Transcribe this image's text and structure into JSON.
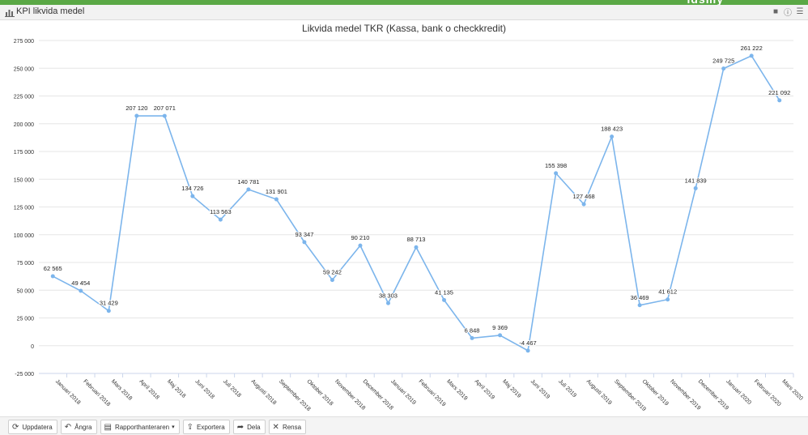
{
  "brand": "ldsmy",
  "panel": {
    "title": "KPI likvida medel"
  },
  "header_icons": [
    "comment-icon",
    "info-icon",
    "menu-icon"
  ],
  "chart_data": {
    "type": "line",
    "title": "Likvida medel TKR (Kassa, bank o checkkredit)",
    "xlabel": "",
    "ylabel": "",
    "categories": [
      "Januari 2018",
      "Februari 2018",
      "Mars 2018",
      "April 2018",
      "Maj 2018",
      "Juni 2018",
      "Juli 2018",
      "Augusti 2018",
      "September 2018",
      "Oktober 2018",
      "November 2018",
      "December 2018",
      "Januari 2019",
      "Februari 2019",
      "Mars 2019",
      "April 2019",
      "Maj 2019",
      "Juni 2019",
      "Juli 2019",
      "Augusti 2019",
      "September 2019",
      "Oktober 2019",
      "November 2019",
      "December 2019",
      "Januari 2020",
      "Februari 2020",
      "Mars 2020"
    ],
    "values": [
      62565,
      49454,
      31429,
      207120,
      207071,
      134726,
      113563,
      140781,
      131901,
      93347,
      59242,
      90210,
      38303,
      88713,
      41135,
      6848,
      9369,
      -4467,
      155398,
      127468,
      188423,
      36469,
      41612,
      141839,
      249725,
      261222,
      221092
    ],
    "labels": [
      "62 565",
      "49 454",
      "31 429",
      "207 120",
      "207 071",
      "134 726",
      "113 563",
      "140 781",
      "131 901",
      "93 347",
      "59 242",
      "90 210",
      "38 303",
      "88 713",
      "41 135",
      "6 848",
      "9 369",
      "-4 467",
      "155 398",
      "127 468",
      "188 423",
      "36 469",
      "41 612",
      "141 839",
      "249 725",
      "261 222",
      "221 092"
    ],
    "yticks": [
      -25000,
      0,
      25000,
      50000,
      75000,
      100000,
      125000,
      150000,
      175000,
      200000,
      225000,
      250000,
      275000
    ],
    "ytick_labels": [
      "-25 000",
      "0",
      "25 000",
      "50 000",
      "75 000",
      "100 000",
      "125 000",
      "150 000",
      "175 000",
      "200 000",
      "225 000",
      "250 000",
      "275 000"
    ],
    "ylim": [
      -25000,
      275000
    ],
    "grid": true,
    "color": "#7cb5ec"
  },
  "footer": {
    "buttons": [
      {
        "label": "Uppdatera",
        "icon": "refresh-icon",
        "glyph": "⟳"
      },
      {
        "label": "Ångra",
        "icon": "undo-icon",
        "glyph": "↶"
      },
      {
        "label": "Rapporthanteraren",
        "icon": "document-icon",
        "glyph": "▤"
      },
      {
        "label": "Exportera",
        "icon": "export-icon",
        "glyph": "⇪"
      },
      {
        "label": "Dela",
        "icon": "share-icon",
        "glyph": "➦"
      },
      {
        "label": "Rensa",
        "icon": "close-icon",
        "glyph": "✕"
      }
    ]
  }
}
